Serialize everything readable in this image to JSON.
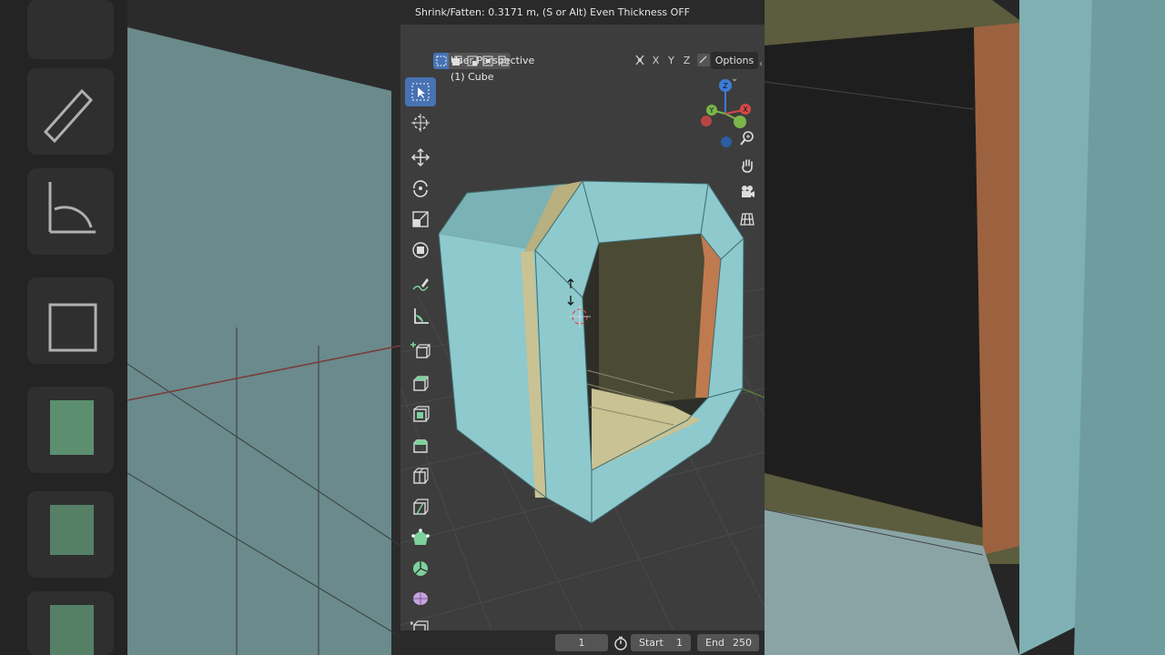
{
  "header": {
    "status_text": "Shrink/Fatten: 0.3171 m, (S or Alt) Even Thickness OFF"
  },
  "viewport": {
    "perspective_label": "User Perspective",
    "object_label": "(1) Cube",
    "options_label": "Options",
    "axis": {
      "x": "X",
      "y": "Y",
      "z": "Z"
    },
    "gizmo": {
      "z": "Z",
      "y": "Y",
      "x": "X"
    }
  },
  "toolbar": {
    "items": [
      {
        "name": "select-box-icon"
      },
      {
        "name": "cursor-icon"
      },
      {
        "name": "move-icon"
      },
      {
        "name": "rotate-icon"
      },
      {
        "name": "scale-icon"
      },
      {
        "name": "transform-icon"
      },
      {
        "name": "annotate-icon"
      },
      {
        "name": "measure-icon"
      },
      {
        "name": "add-cube-icon"
      },
      {
        "name": "extrude-icon"
      },
      {
        "name": "inset-icon"
      },
      {
        "name": "bevel-icon"
      },
      {
        "name": "loop-cut-icon"
      },
      {
        "name": "knife-icon"
      },
      {
        "name": "poly-build-icon"
      },
      {
        "name": "spin-icon"
      },
      {
        "name": "smooth-icon"
      },
      {
        "name": "edge-slide-icon"
      }
    ]
  },
  "timeline": {
    "current_frame": "1",
    "start_label": "Start",
    "start_value": "1",
    "end_label": "End",
    "end_value": "250"
  },
  "colors": {
    "accent": "#4772b3",
    "mesh": "#8ec9cd",
    "inner": "#c9c293",
    "selected_edge": "#c07a4f"
  }
}
